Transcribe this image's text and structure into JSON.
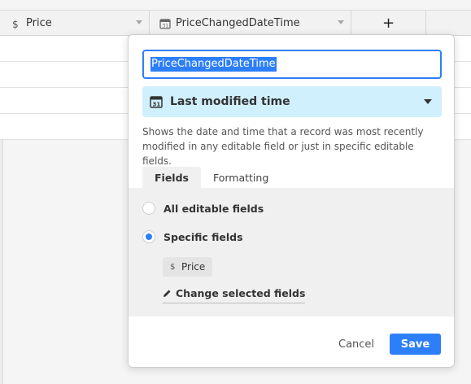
{
  "grid": {
    "columns": [
      {
        "label": "Price",
        "icon": "currency-icon"
      },
      {
        "label": "PriceChangedDateTime",
        "icon": "calendar-icon"
      }
    ],
    "add_column_label": "+"
  },
  "dialog": {
    "field_name": "PriceChangedDateTime",
    "field_type": "Last modified time",
    "description": "Shows the date and time that a record was most recently modified in any editable field or just in specific editable fields.",
    "tabs": [
      {
        "label": "Fields",
        "active": true
      },
      {
        "label": "Formatting",
        "active": false
      }
    ],
    "options": [
      {
        "label": "All editable fields",
        "selected": false
      },
      {
        "label": "Specific fields",
        "selected": true
      }
    ],
    "selected_field": {
      "label": "Price",
      "icon": "currency-icon"
    },
    "change_fields_label": "Change selected fields",
    "cancel_label": "Cancel",
    "save_label": "Save"
  },
  "colors": {
    "accent": "#2d7ff9",
    "type_select_bg": "#d0f0fd",
    "panel_bg": "#f0f0f0"
  }
}
